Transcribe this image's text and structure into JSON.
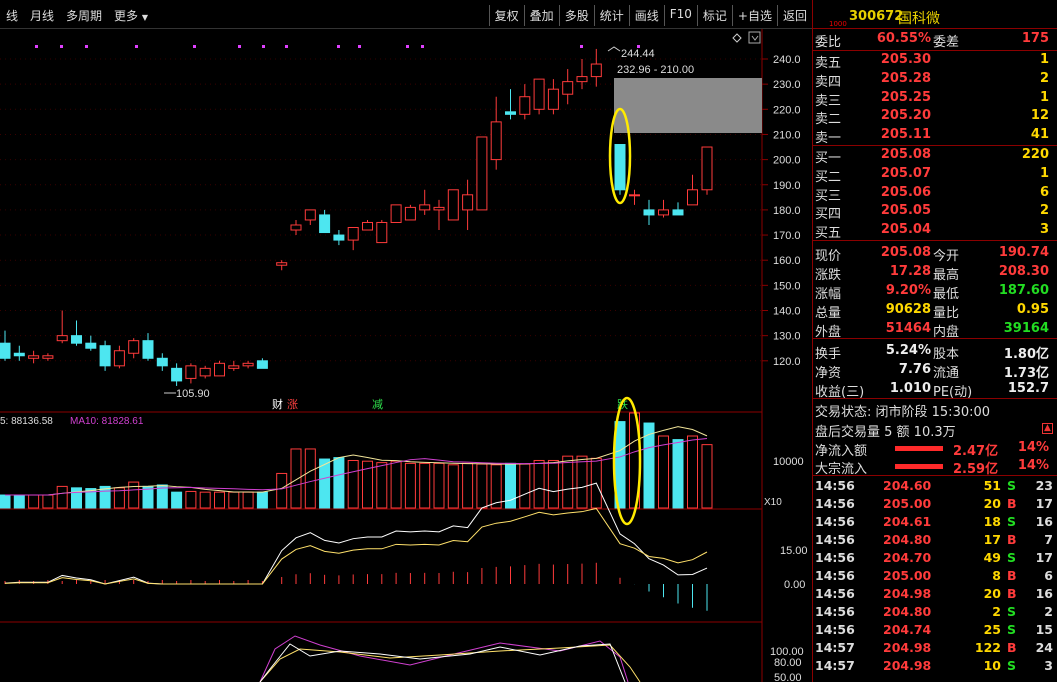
{
  "toolbar": {
    "left": [
      "线",
      "月线",
      "多周期",
      "更多"
    ],
    "right": [
      "复权",
      "叠加",
      "多股",
      "统计",
      "画线",
      "F10",
      "标记",
      "+自选",
      "返回"
    ]
  },
  "chart": {
    "price_axis": [
      "240.0",
      "230.0",
      "220.0",
      "210.0",
      "200.0",
      "190.0",
      "180.0",
      "170.0",
      "160.0",
      "150.0",
      "140.0",
      "130.0",
      "120.0"
    ],
    "high_label": "244.44",
    "range_label": "232.96 - 210.00",
    "low_label": "105.90",
    "markers": [
      "财",
      "涨",
      "减",
      "跌"
    ],
    "vol_legend": "5: 88136.58",
    "vol_ma10": "MA10: 81828.61",
    "vol_axis": "10000",
    "vol_unit": "X10",
    "macd_axis": [
      "15.00",
      "0.00"
    ],
    "kdj_axis": [
      "100.00",
      "80.00",
      "50.00"
    ]
  },
  "chart_data": {
    "type": "candlestick",
    "series": [
      {
        "name": "candles",
        "values": [
          [
            127,
            132,
            120,
            121
          ],
          [
            123,
            126,
            120,
            122
          ],
          [
            121,
            124,
            119,
            122
          ],
          [
            121,
            123,
            120,
            122
          ],
          [
            128,
            140,
            127,
            130
          ],
          [
            130,
            136,
            126,
            127
          ],
          [
            127,
            130,
            124,
            125
          ],
          [
            126,
            128,
            116,
            118
          ],
          [
            118,
            126,
            117,
            124
          ],
          [
            123,
            129,
            121,
            128
          ],
          [
            128,
            131,
            120,
            121
          ],
          [
            121,
            123,
            116,
            118
          ],
          [
            117,
            119,
            110,
            112
          ],
          [
            113,
            119,
            111,
            118
          ],
          [
            114,
            118,
            113,
            117
          ],
          [
            114,
            120,
            114,
            119
          ],
          [
            117,
            120,
            116,
            118
          ],
          [
            118,
            120,
            117,
            119
          ],
          [
            120,
            121,
            117,
            117
          ],
          [
            158,
            160,
            156,
            159
          ],
          [
            172,
            176,
            170,
            174
          ],
          [
            176,
            180,
            174,
            180
          ],
          [
            178,
            180,
            171,
            171
          ],
          [
            170,
            172,
            166,
            168
          ],
          [
            168,
            169,
            164,
            173
          ],
          [
            172,
            176,
            172,
            175
          ],
          [
            167,
            176,
            167,
            175
          ],
          [
            175,
            182,
            175,
            182
          ],
          [
            176,
            182,
            176,
            181
          ],
          [
            180,
            188,
            178,
            182
          ],
          [
            180,
            184,
            172,
            181
          ],
          [
            176,
            188,
            176,
            188
          ],
          [
            180,
            192,
            172,
            186
          ],
          [
            180,
            209,
            180,
            209
          ],
          [
            200,
            225,
            196,
            215
          ],
          [
            219,
            228,
            216,
            218
          ],
          [
            218,
            230,
            216,
            225
          ],
          [
            220,
            232,
            218,
            232
          ],
          [
            220,
            232,
            218,
            228
          ],
          [
            226,
            236,
            222,
            231
          ],
          [
            231,
            240,
            228,
            233
          ],
          [
            233,
            244,
            229,
            238
          ],
          [
            206,
            206,
            186,
            188
          ],
          [
            186,
            188,
            182,
            186
          ],
          [
            180,
            184,
            174,
            178
          ],
          [
            178,
            184,
            177,
            180
          ],
          [
            180,
            183,
            178,
            178
          ],
          [
            182,
            194,
            182,
            188
          ],
          [
            188,
            205,
            186,
            205
          ]
        ]
      },
      {
        "name": "volume",
        "values": [
          18,
          18,
          18,
          18,
          30,
          28,
          27,
          30,
          28,
          36,
          30,
          32,
          22,
          23,
          22,
          22,
          22,
          22,
          22,
          48,
          82,
          82,
          68,
          70,
          66,
          65,
          63,
          65,
          62,
          62,
          62,
          60,
          62,
          61,
          60,
          62,
          61,
          66,
          66,
          72,
          72,
          69,
          120,
          132,
          118,
          100,
          95,
          100,
          88
        ]
      }
    ],
    "ylim": [
      105,
      245
    ]
  },
  "panel": {
    "tag": "1000",
    "code": "300672",
    "name": "国科微",
    "weibi_label": "委比",
    "weibi": "60.55%",
    "weicha_label": "委差",
    "weicha": "175",
    "asks": [
      {
        "label": "卖五",
        "price": "205.30",
        "vol": "1"
      },
      {
        "label": "卖四",
        "price": "205.28",
        "vol": "2"
      },
      {
        "label": "卖三",
        "price": "205.25",
        "vol": "1"
      },
      {
        "label": "卖二",
        "price": "205.20",
        "vol": "12"
      },
      {
        "label": "卖一",
        "price": "205.11",
        "vol": "41"
      }
    ],
    "bids": [
      {
        "label": "买一",
        "price": "205.08",
        "vol": "220"
      },
      {
        "label": "买二",
        "price": "205.07",
        "vol": "1"
      },
      {
        "label": "买三",
        "price": "205.06",
        "vol": "6"
      },
      {
        "label": "买四",
        "price": "205.05",
        "vol": "2"
      },
      {
        "label": "买五",
        "price": "205.04",
        "vol": "3"
      }
    ],
    "stats": [
      {
        "l1": "现价",
        "v1": "205.08",
        "c1": "red",
        "l2": "今开",
        "v2": "190.74",
        "c2": "red"
      },
      {
        "l1": "涨跌",
        "v1": "17.28",
        "c1": "red",
        "l2": "最高",
        "v2": "208.30",
        "c2": "red"
      },
      {
        "l1": "涨幅",
        "v1": "9.20%",
        "c1": "red",
        "l2": "最低",
        "v2": "187.60",
        "c2": "green"
      },
      {
        "l1": "总量",
        "v1": "90628",
        "c1": "yellow",
        "l2": "量比",
        "v2": "0.95",
        "c2": "yellow"
      },
      {
        "l1": "外盘",
        "v1": "51464",
        "c1": "red",
        "l2": "内盘",
        "v2": "39164",
        "c2": "green"
      }
    ],
    "stats2": [
      {
        "l1": "换手",
        "v1": "5.24%",
        "l2": "股本",
        "v2": "1.80亿"
      },
      {
        "l1": "净资",
        "v1": "7.76",
        "l2": "流通",
        "v2": "1.73亿"
      },
      {
        "l1": "收益(三)",
        "v1": "1.010",
        "l2": "PE(动)",
        "v2": "152.7"
      }
    ],
    "state": "交易状态: 闭市阶段 15:30:00",
    "after": "盘后交易量 5 额 10.3万",
    "flows": [
      {
        "label": "净流入额",
        "value": "2.47亿",
        "pct": "14%"
      },
      {
        "label": "大宗流入",
        "value": "2.59亿",
        "pct": "14%"
      }
    ],
    "ticks": [
      {
        "time": "14:56",
        "price": "204.60",
        "vol": "51",
        "bs": "S",
        "cnt": "23"
      },
      {
        "time": "14:56",
        "price": "205.00",
        "vol": "20",
        "bs": "B",
        "cnt": "17"
      },
      {
        "time": "14:56",
        "price": "204.61",
        "vol": "18",
        "bs": "S",
        "cnt": "16"
      },
      {
        "time": "14:56",
        "price": "204.80",
        "vol": "17",
        "bs": "B",
        "cnt": "7"
      },
      {
        "time": "14:56",
        "price": "204.70",
        "vol": "49",
        "bs": "S",
        "cnt": "17"
      },
      {
        "time": "14:56",
        "price": "205.00",
        "vol": "8",
        "bs": "B",
        "cnt": "6"
      },
      {
        "time": "14:56",
        "price": "204.98",
        "vol": "20",
        "bs": "B",
        "cnt": "16"
      },
      {
        "time": "14:56",
        "price": "204.80",
        "vol": "2",
        "bs": "S",
        "cnt": "2"
      },
      {
        "time": "14:56",
        "price": "204.74",
        "vol": "25",
        "bs": "S",
        "cnt": "15"
      },
      {
        "time": "14:57",
        "price": "204.98",
        "vol": "122",
        "bs": "B",
        "cnt": "24"
      },
      {
        "time": "14:57",
        "price": "204.98",
        "vol": "10",
        "bs": "S",
        "cnt": "3"
      }
    ]
  }
}
